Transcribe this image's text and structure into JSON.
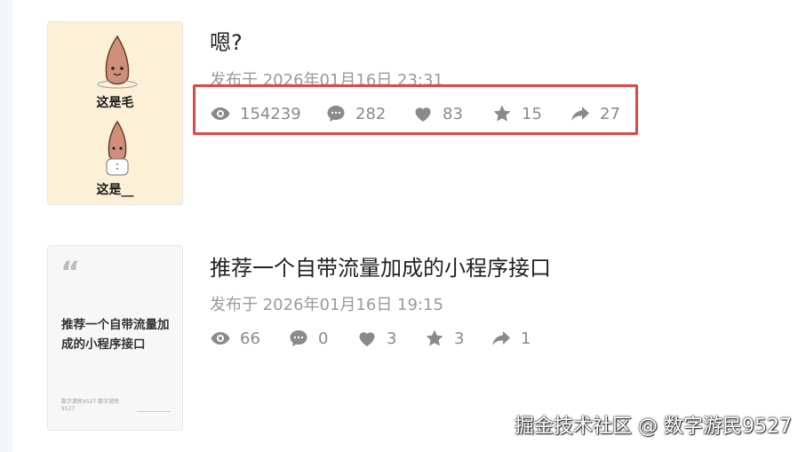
{
  "posts": [
    {
      "title": "嗯?",
      "date": "发布于 2026年01月16日 23:31",
      "thumb_caption_top": "这是毛",
      "thumb_caption_bottom": "这是__",
      "stats": {
        "views": "154239",
        "comments": "282",
        "likes": "83",
        "favorites": "15",
        "shares": "27"
      }
    },
    {
      "title": "推荐一个自带流量加成的小程序接口",
      "date": "发布于 2026年01月16日 19:15",
      "thumb_title": "推荐一个自带流量加成的小程序接口",
      "thumb_quote": "“",
      "thumb_footer": "数字游民9527 数字游民9527",
      "stats": {
        "views": "66",
        "comments": "0",
        "likes": "3",
        "favorites": "3",
        "shares": "1"
      }
    }
  ],
  "watermark": "掘金技术社区 @ 数字游民9527",
  "colors": {
    "highlight": "#e04848",
    "meta_text": "#8a8a8a",
    "title_text": "#222222"
  },
  "icons": [
    "eye-icon",
    "comment-icon",
    "heart-icon",
    "star-icon",
    "share-icon"
  ]
}
